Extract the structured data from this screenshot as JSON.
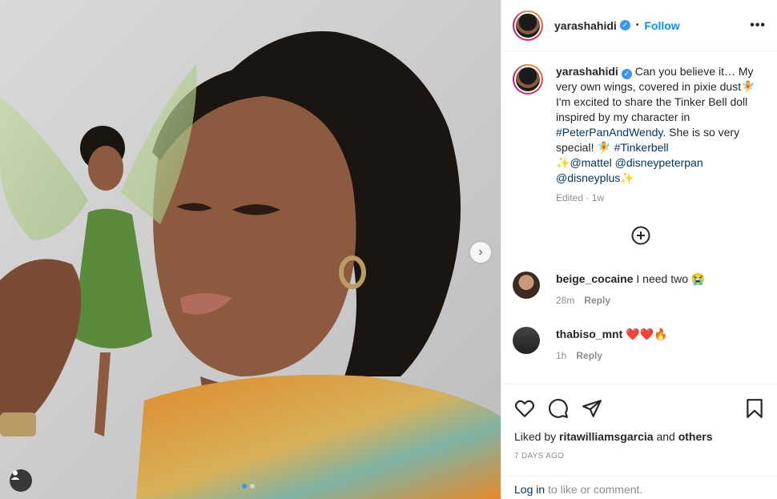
{
  "post": {
    "username": "yarashahidi",
    "verified_mark": "✓",
    "separator": "•",
    "follow_label": "Follow",
    "more_label": "•••",
    "caption": {
      "part1": "Can you believe it… My very own wings, covered in pixie dust",
      "emoji_fairy": "🧚",
      "part2": "I'm excited to share the Tinker Bell doll inspired by my character in ",
      "hashtag1": "#PeterPanAndWendy",
      "part3": ". She is so very special! ",
      "emoji_fairy2": "🧚",
      "hashtag2": " #Tinkerbell",
      "sparkles": "✨",
      "mention1": "@mattel",
      "mention2": " @disneypeterpan",
      "mention3": "@disneyplus",
      "sparkles2": "✨"
    },
    "edited": "Edited · 1w"
  },
  "comments": [
    {
      "username": "beige_cocaine",
      "text": "I need two 😭",
      "time": "28m",
      "reply": "Reply"
    },
    {
      "username": "thabiso_mnt",
      "text": "❤️❤️🔥",
      "time": "1h",
      "reply": "Reply"
    }
  ],
  "likes": {
    "prefix": "Liked by ",
    "user": "ritawilliamsgarcia",
    "middle": " and ",
    "others": "others"
  },
  "date": "7 DAYS AGO",
  "login": {
    "link": "Log in",
    "rest": " to like or comment."
  },
  "carousel": {
    "next": "›",
    "count": 2,
    "active": 0
  },
  "colors": {
    "accent": "#0095f6",
    "link": "#00376b",
    "muted": "#8e8e8e"
  }
}
